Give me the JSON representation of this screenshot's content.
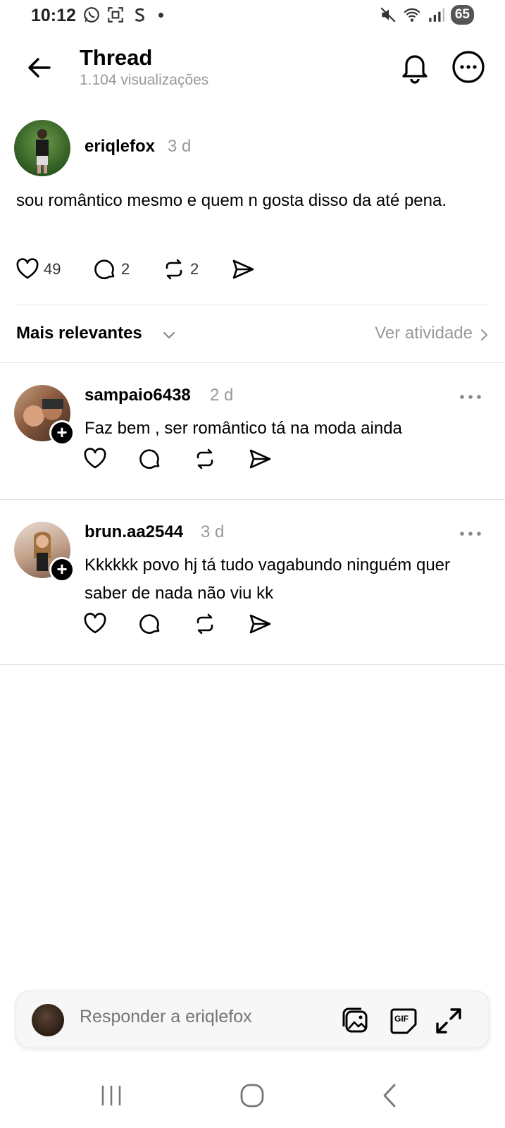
{
  "status": {
    "time": "10:12",
    "battery": "65"
  },
  "header": {
    "title": "Thread",
    "views": "1.104 visualizações"
  },
  "post": {
    "username": "eriqlefox",
    "time": "3 d",
    "text": "sou romântico mesmo e quem n gosta disso da até pena.",
    "likes": "49",
    "comments": "2",
    "reposts": "2"
  },
  "sort": {
    "label": "Mais relevantes",
    "activity": "Ver atividade"
  },
  "comments": [
    {
      "username": "sampaio6438",
      "time": "2 d",
      "text": "Faz bem , ser romântico tá na moda ainda"
    },
    {
      "username": "brun.aa2544",
      "time": "3 d",
      "text": "Kkkkkk povo hj tá tudo vagabundo ninguém quer saber de nada não viu kk"
    }
  ],
  "reply": {
    "placeholder": "Responder a eriqlefox",
    "gif_label": "GIF"
  }
}
